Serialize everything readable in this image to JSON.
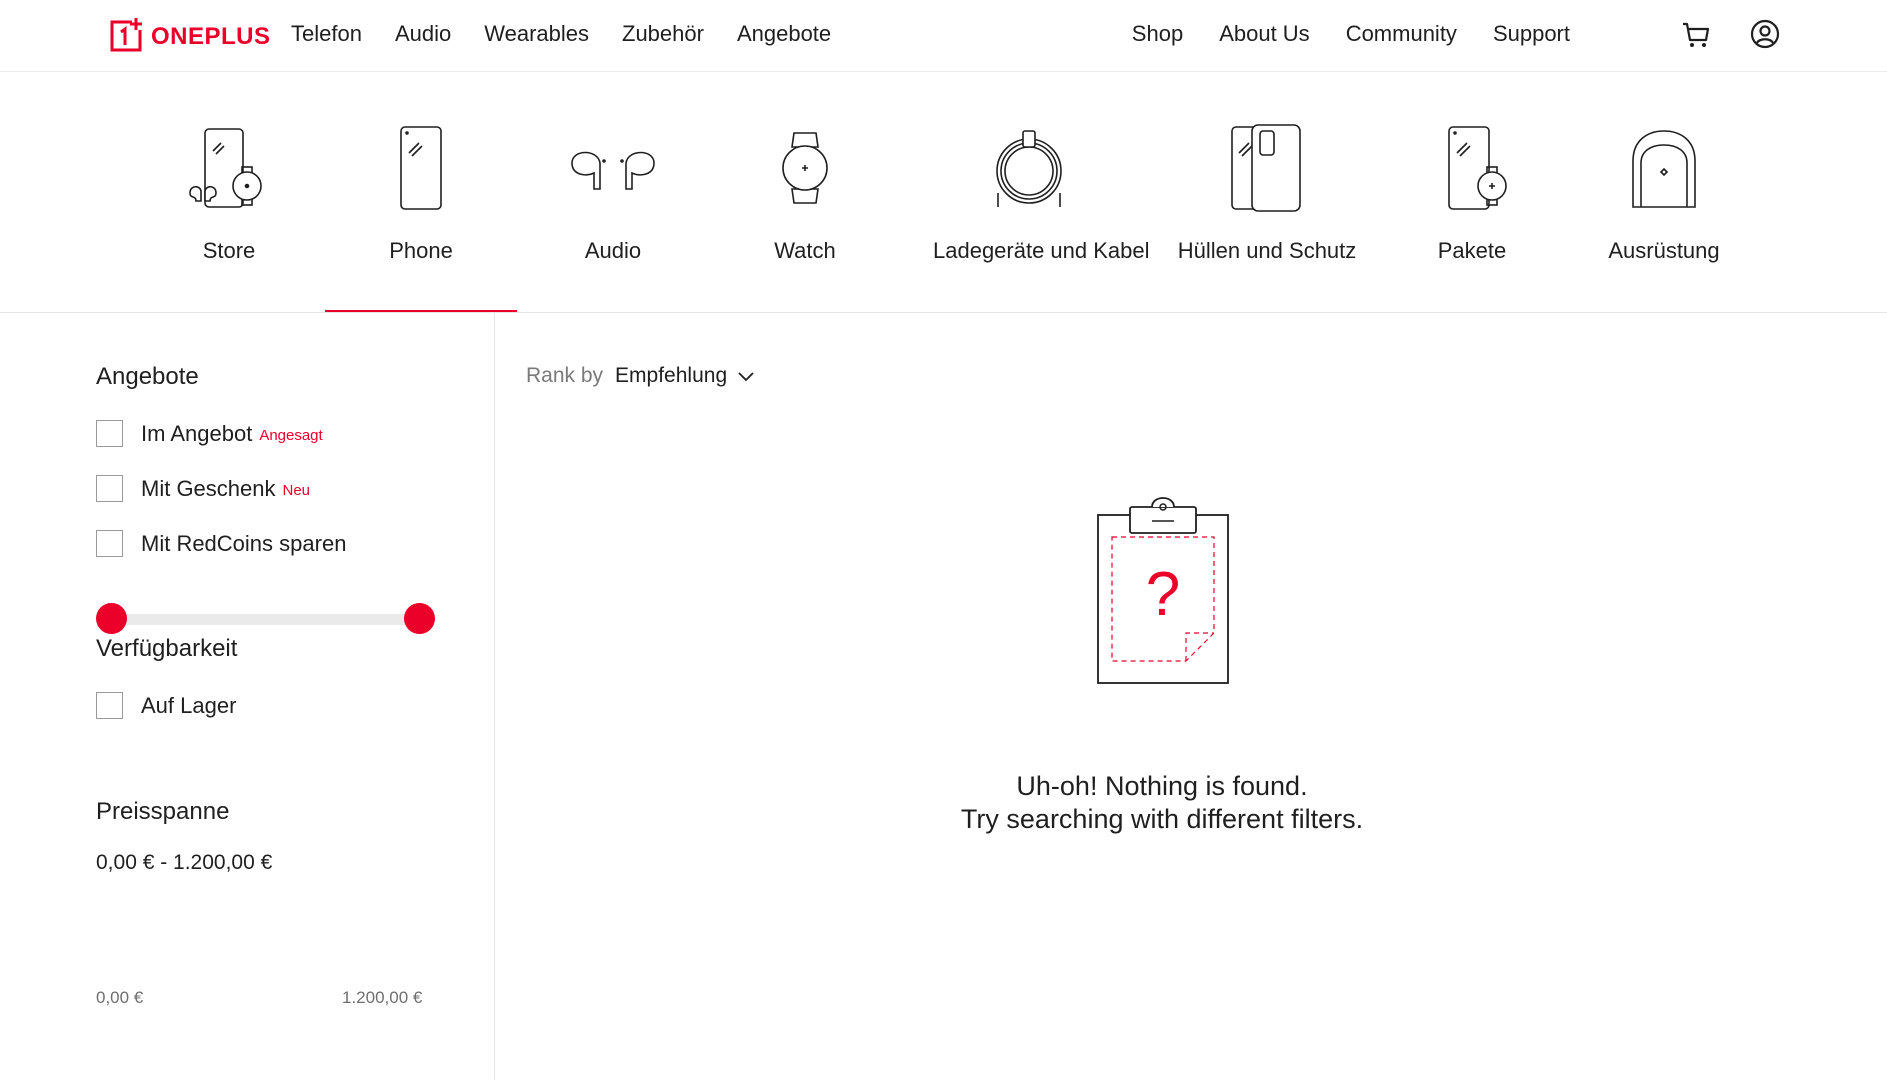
{
  "header": {
    "logo_text": "ONEPLUS",
    "nav_left": [
      "Telefon",
      "Audio",
      "Wearables",
      "Zubehör",
      "Angebote"
    ],
    "nav_right": [
      "Shop",
      "About Us",
      "Community",
      "Support"
    ],
    "icons": [
      "cart-icon",
      "user-icon"
    ]
  },
  "categories": [
    {
      "label": "Store",
      "icon": "store-icon"
    },
    {
      "label": "Phone",
      "icon": "phone-icon",
      "active": true
    },
    {
      "label": "Audio",
      "icon": "earbuds-icon"
    },
    {
      "label": "Watch",
      "icon": "watch-icon"
    },
    {
      "label": "Ladegeräte und Kabel",
      "icon": "cable-icon"
    },
    {
      "label": "Hüllen und Schutz",
      "icon": "case-icon"
    },
    {
      "label": "Pakete",
      "icon": "bundle-icon"
    },
    {
      "label": "Ausrüstung",
      "icon": "backpack-icon"
    }
  ],
  "filters": {
    "offers": {
      "title": "Angebote",
      "items": [
        {
          "label": "Im Angebot",
          "tag": "Angesagt"
        },
        {
          "label": "Mit Geschenk",
          "tag": "Neu"
        },
        {
          "label": "Mit RedCoins sparen",
          "tag": ""
        }
      ]
    },
    "availability": {
      "title": "Verfügbarkeit",
      "items": [
        {
          "label": "Auf Lager"
        }
      ]
    },
    "price": {
      "title": "Preisspanne",
      "range_text": "0,00 € - 1.200,00 €",
      "min_label": "0,00 €",
      "max_label": "1.200,00 €"
    }
  },
  "sort": {
    "label": "Rank by",
    "value": "Empfehlung"
  },
  "empty_state": {
    "line1": "Uh-oh! Nothing is found.",
    "line2": "Try searching with different filters."
  },
  "colors": {
    "accent": "#eb0029",
    "text": "#1f1f1f",
    "muted": "#7a7a7a"
  }
}
